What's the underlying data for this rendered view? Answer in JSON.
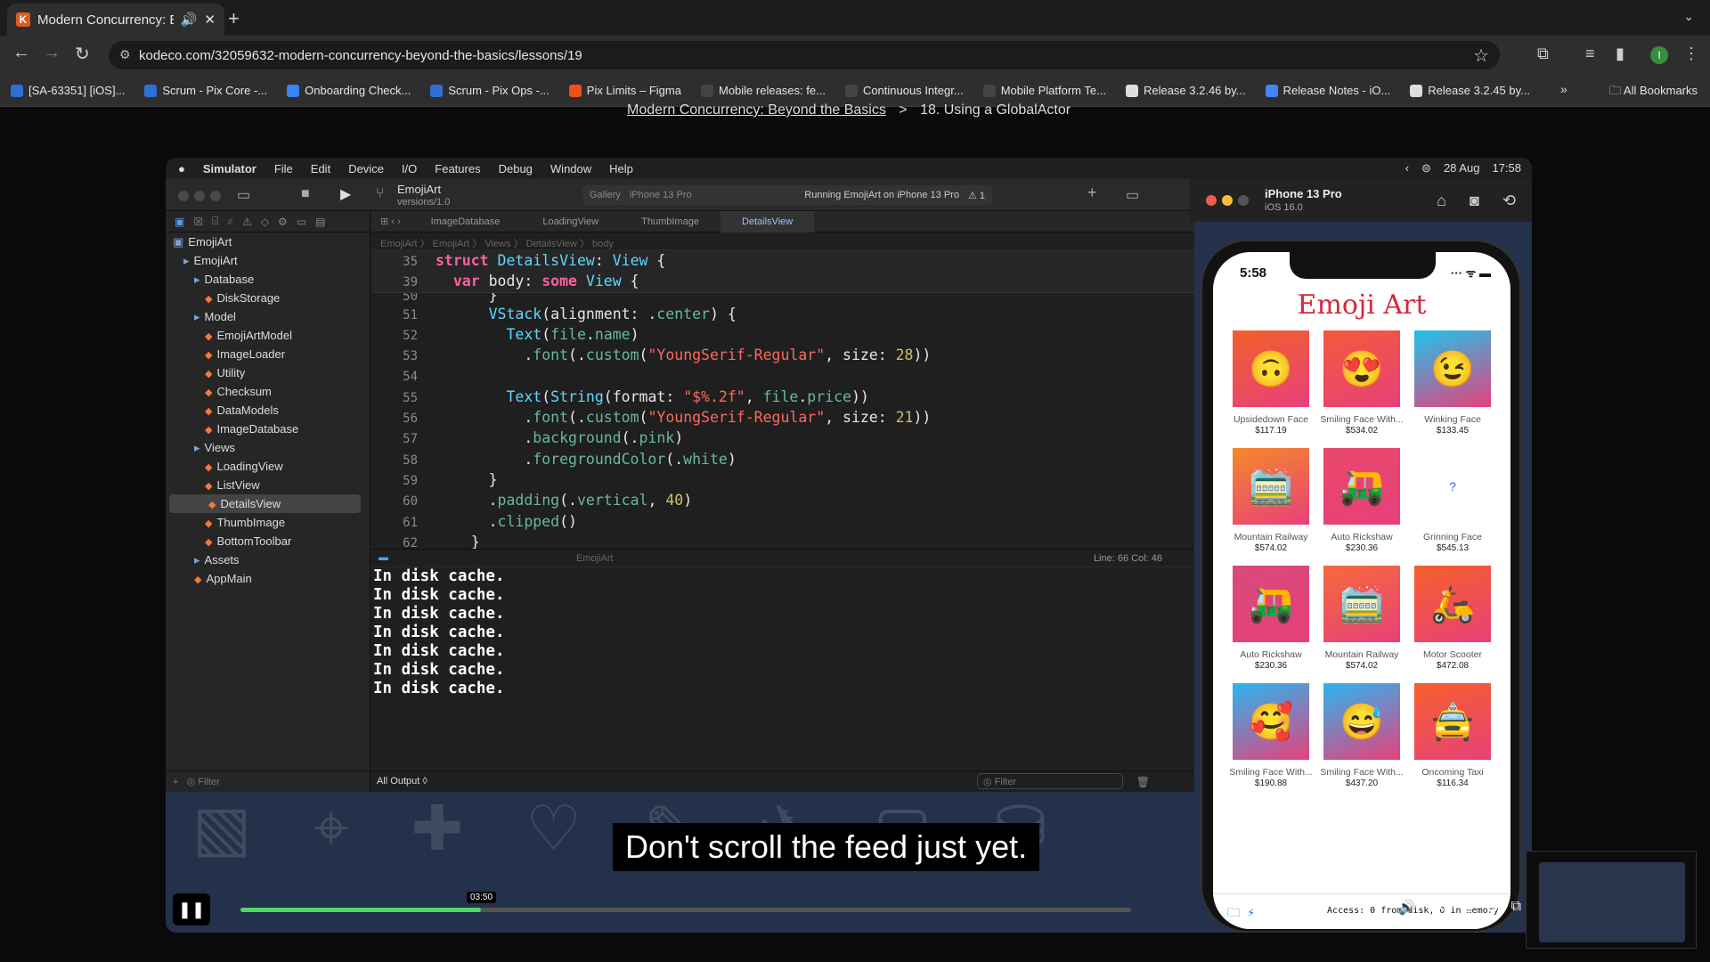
{
  "browser": {
    "tab_title": "Modern Concurrency: Beyon",
    "url": "kodeco.com/32059632-modern-concurrency-beyond-the-basics/lessons/19",
    "avatar": "I",
    "bookmarks": [
      "[SA-63351] [iOS]...",
      "Scrum - Pix Core -...",
      "Onboarding Check...",
      "Scrum - Pix Ops -...",
      "Pix Limits – Figma",
      "Mobile releases: fe...",
      "Continuous Integr...",
      "Mobile Platform Te...",
      "Release 3.2.46 by...",
      "Release Notes - iO...",
      "Release 3.2.45 by..."
    ],
    "all_bookmarks": "All Bookmarks"
  },
  "breadcrumb": {
    "course": "Modern Concurrency: Beyond the Basics",
    "sep": ">",
    "lesson": "18. Using a GlobalActor"
  },
  "mac": {
    "app": "Simulator",
    "menus": [
      "File",
      "Edit",
      "Device",
      "I/O",
      "Features",
      "Debug",
      "Window",
      "Help"
    ],
    "date": "28 Aug",
    "time": "17:58"
  },
  "xcode": {
    "scheme": "EmojiArt",
    "branch": "versions/1.0",
    "dest_gallery": "Gallery",
    "dest_device": "iPhone 13 Pro",
    "status": "Running EmojiArt on iPhone 13 Pro",
    "warnings": "1",
    "tabs": [
      "ImageDatabase",
      "LoadingView",
      "ThumbImage",
      "DetailsView"
    ],
    "jumpbar": "EmojiArt 〉 EmojiArt 〉 Views 〉 DetailsView 〉 body",
    "tree": [
      {
        "label": "EmojiArt",
        "kind": "project",
        "indent": 0
      },
      {
        "label": "EmojiArt",
        "kind": "folder",
        "indent": 1
      },
      {
        "label": "Database",
        "kind": "folder",
        "indent": 2
      },
      {
        "label": "DiskStorage",
        "kind": "file",
        "indent": 3
      },
      {
        "label": "Model",
        "kind": "folder",
        "indent": 2
      },
      {
        "label": "EmojiArtModel",
        "kind": "file",
        "indent": 3
      },
      {
        "label": "ImageLoader",
        "kind": "file",
        "indent": 3
      },
      {
        "label": "Utility",
        "kind": "file",
        "indent": 3
      },
      {
        "label": "Checksum",
        "kind": "file",
        "indent": 3
      },
      {
        "label": "DataModels",
        "kind": "file",
        "indent": 3
      },
      {
        "label": "ImageDatabase",
        "kind": "file",
        "indent": 3
      },
      {
        "label": "Views",
        "kind": "folder",
        "indent": 2
      },
      {
        "label": "LoadingView",
        "kind": "file",
        "indent": 3
      },
      {
        "label": "ListView",
        "kind": "file",
        "indent": 3
      },
      {
        "label": "DetailsView",
        "kind": "file",
        "indent": 3,
        "selected": true
      },
      {
        "label": "ThumbImage",
        "kind": "file",
        "indent": 3
      },
      {
        "label": "BottomToolbar",
        "kind": "file",
        "indent": 3
      },
      {
        "label": "Assets",
        "kind": "folder",
        "indent": 2
      },
      {
        "label": "AppMain",
        "kind": "file",
        "indent": 2
      }
    ],
    "filter_placeholder": "Filter",
    "cursor": "Line: 66  Col: 46",
    "console_lines": [
      "In disk cache.",
      "In disk cache.",
      "In disk cache.",
      "In disk cache.",
      "In disk cache.",
      "In disk cache.",
      "In disk cache."
    ],
    "console_scope": "All Output ◊",
    "console_filter": "Filter",
    "console_target": "EmojiArt"
  },
  "simulator": {
    "device": "iPhone 13 Pro",
    "os": "iOS 16.0",
    "phone_time": "5:58",
    "app_title": "Emoji Art",
    "items": [
      {
        "name": "Upsidedown Face",
        "price": "$117.19",
        "emoji": "🙃",
        "color": "#f2602a"
      },
      {
        "name": "Smiling Face With...",
        "price": "$534.02",
        "emoji": "😍",
        "color": "#f25a3a"
      },
      {
        "name": "Winking Face",
        "price": "$133.45",
        "emoji": "😉",
        "color": "#1ec4ee"
      },
      {
        "name": "Mountain Railway",
        "price": "$574.02",
        "emoji": "🚞",
        "color": "#f5882a"
      },
      {
        "name": "Auto Rickshaw",
        "price": "$230.36",
        "emoji": "🛺",
        "color": "#e8486a"
      },
      {
        "name": "Grinning Face",
        "price": "$545.13",
        "emoji": "?",
        "color": "#ffffff"
      },
      {
        "name": "Auto Rickshaw",
        "price": "$230.36",
        "emoji": "🛺",
        "color": "#d84a7a"
      },
      {
        "name": "Mountain Railway",
        "price": "$574.02",
        "emoji": "🚞",
        "color": "#f56a3a"
      },
      {
        "name": "Motor Scooter",
        "price": "$472.08",
        "emoji": "🛵",
        "color": "#f5602a"
      },
      {
        "name": "Smiling Face With...",
        "price": "$190.88",
        "emoji": "🥰",
        "color": "#2ab6f0"
      },
      {
        "name": "Smiling Face With...",
        "price": "$437.20",
        "emoji": "😅",
        "color": "#2ab6f0"
      },
      {
        "name": "Oncoming Taxi",
        "price": "$116.34",
        "emoji": "🚖",
        "color": "#f5602a"
      }
    ],
    "access": "Access: 0 from disk, 0 in memory"
  },
  "video": {
    "caption": "Don't scroll the feed just yet.",
    "time": "03:50",
    "progress": 0.27
  }
}
